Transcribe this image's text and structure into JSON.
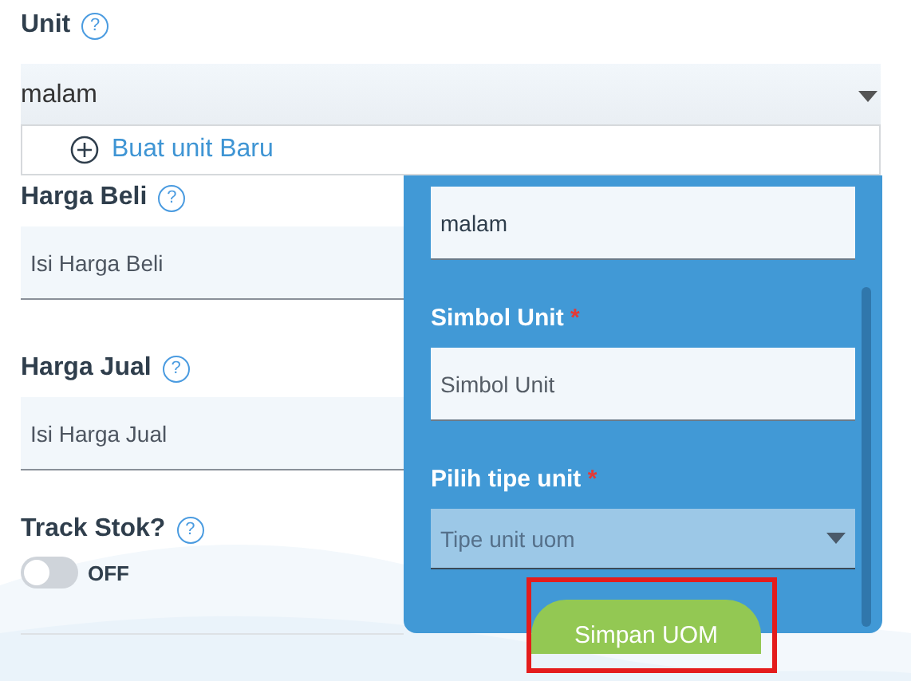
{
  "unit_field": {
    "label": "Unit",
    "help": "?",
    "value": "malam"
  },
  "unit_dropdown": {
    "options": [
      {
        "kind": "create",
        "label": "Buat unit Baru"
      }
    ]
  },
  "fields": [
    {
      "label": "Harga Beli",
      "help": "?",
      "placeholder": "Isi Harga Beli"
    },
    {
      "label": "Harga Jual",
      "help": "?",
      "placeholder": "Isi Harga Jual"
    }
  ],
  "track_stock": {
    "label": "Track Stok?",
    "help": "?",
    "on": false,
    "state_text": "OFF"
  },
  "new_unit_panel": {
    "fields": [
      {
        "kind": "input",
        "value": "malam"
      },
      {
        "kind": "input",
        "label": "Simbol Unit",
        "required_mark": "*",
        "placeholder": "Simbol Unit"
      },
      {
        "kind": "select",
        "label": "Pilih tipe unit",
        "required_mark": "*",
        "placeholder": "Tipe unit uom"
      }
    ],
    "save_button": {
      "label": "Simpan UOM",
      "highlighted": true
    }
  }
}
